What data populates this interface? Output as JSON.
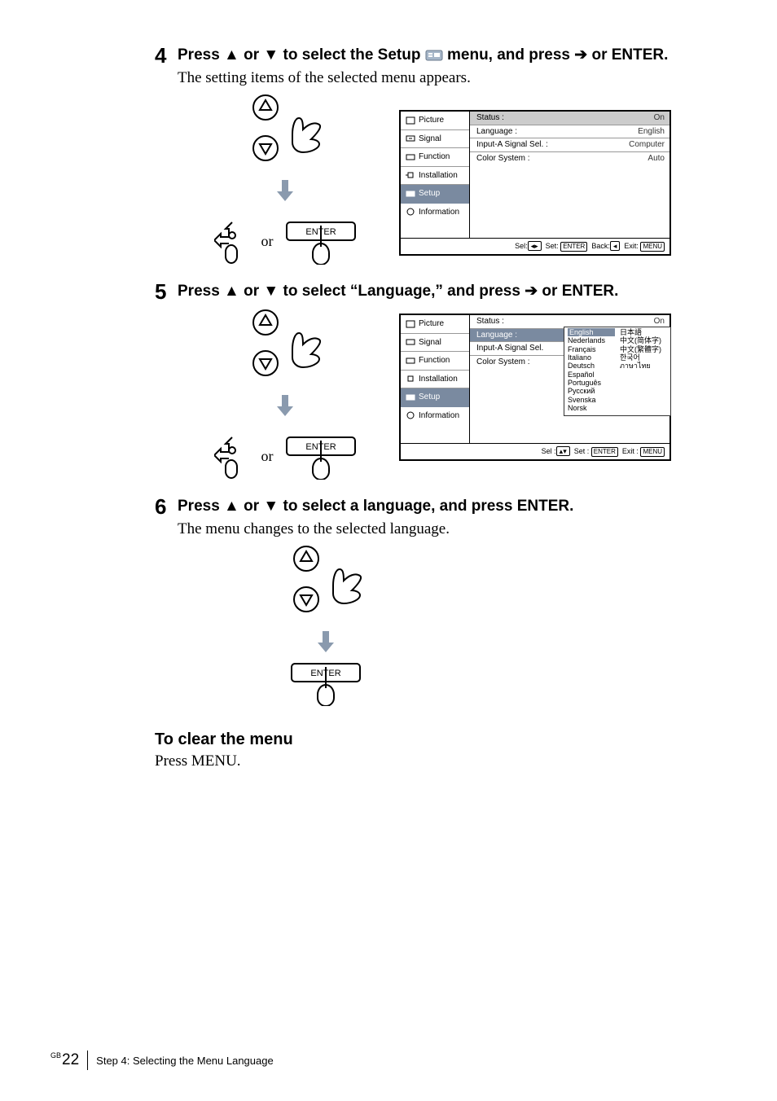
{
  "steps": {
    "s4": {
      "num": "4",
      "title_before": "Press ",
      "title_mid": " or ",
      "title_mid2": " to select the Setup ",
      "title_after": "  menu, and press ",
      "title_end": " or ENTER.",
      "desc": "The setting items of the selected menu appears.",
      "or": "or"
    },
    "s5": {
      "num": "5",
      "title_before": "Press ",
      "title_mid": " or ",
      "title_after": " to select “Language,” and press ",
      "title_end": " or ENTER.",
      "or": "or"
    },
    "s6": {
      "num": "6",
      "title_before": "Press ",
      "title_mid": " or ",
      "title_after": " to select a language, and press ENTER.",
      "desc": "The menu changes to the selected language."
    }
  },
  "menu": {
    "side": {
      "picture": "Picture",
      "signal": "Signal",
      "function": "Function",
      "installation": "Installation",
      "setup": "Setup",
      "information": "Information"
    },
    "rows4": {
      "status_k": "Status :",
      "status_v": "On",
      "lang_k": "Language :",
      "lang_v": "English",
      "inA_k": "Input-A Signal Sel. :",
      "inA_v": "Computer",
      "cs_k": "Color System :",
      "cs_v": "Auto"
    },
    "rows5": {
      "status_k": "Status :",
      "status_v": "On",
      "lang_k": "Language :",
      "lang_v": "English",
      "inA_k": "Input-A Signal Sel.",
      "cs_k": "Color System :"
    },
    "langs": {
      "l0": "English",
      "r0": "日本語",
      "l1": "Nederlands",
      "r1": "中文(简体字)",
      "l2": "Français",
      "r2": "中文(繁體字)",
      "l3": "Italiano",
      "r3": "한국어",
      "l4": "Deutsch",
      "r4": "ภาษาไทย",
      "l5": "Español",
      "r5": "",
      "l6": "Português",
      "r6": "",
      "l7": "Русский",
      "r7": "",
      "l8": "Svenska",
      "r8": "",
      "l9": "Norsk",
      "r9": ""
    },
    "foot4": {
      "sel": "Sel:",
      "set": "Set:",
      "back": "Back:",
      "exit": "Exit:",
      "enter": "ENTER",
      "menu": "MENU"
    },
    "foot5": {
      "sel": "Sel :",
      "set": "Set :",
      "exit": "Exit :",
      "enter": "ENTER",
      "menu": "MENU"
    }
  },
  "enter_label": "ENTER",
  "clear": {
    "title": "To clear the menu",
    "desc": "Press MENU."
  },
  "footer": {
    "pre": "GB",
    "page": "22",
    "text": "Step 4: Selecting the Menu Language"
  }
}
